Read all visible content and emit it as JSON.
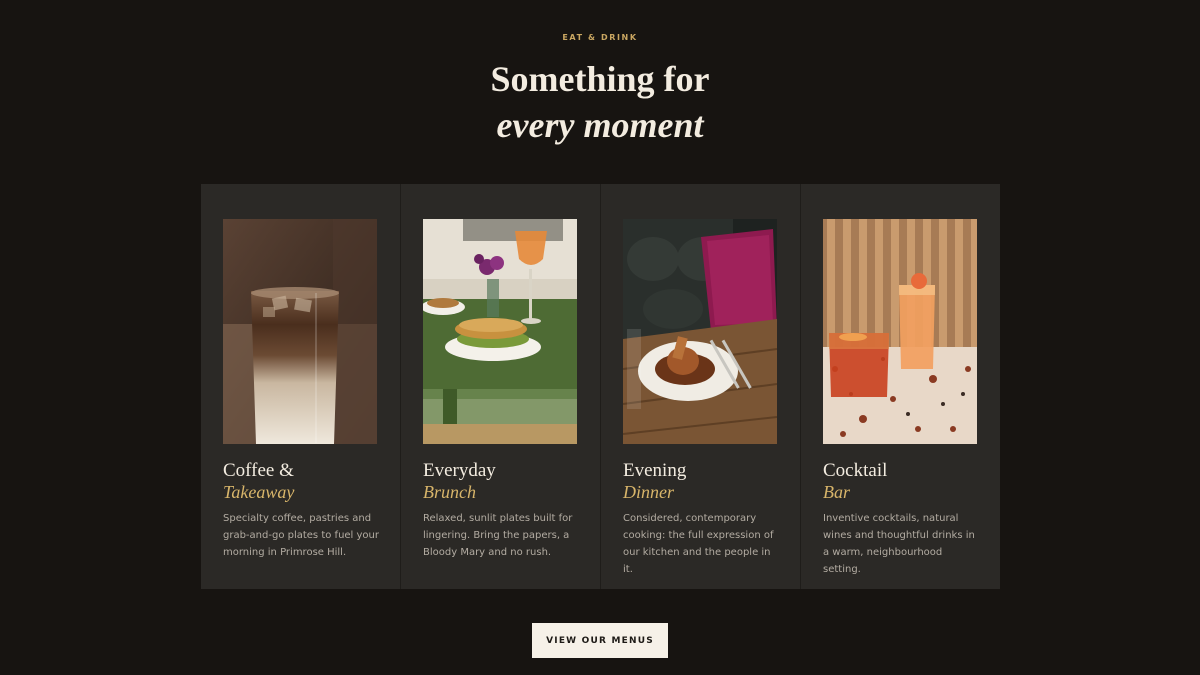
{
  "section": {
    "eyebrow": "EAT & DRINK",
    "heading_line1": "Something for",
    "heading_line2": "every moment"
  },
  "cards": [
    {
      "title": "Coffee &",
      "subtitle": "Takeaway",
      "description": "Specialty coffee, pastries and grab-and-go plates to fuel your morning in Primrose Hill.",
      "image": "iced-latte-photo"
    },
    {
      "title": "Everyday",
      "subtitle": "Brunch",
      "description": "Relaxed, sunlit plates built for lingering. Bring the papers, a Bloody Mary and no rush.",
      "image": "brunch-sandwich-photo"
    },
    {
      "title": "Evening",
      "subtitle": "Dinner",
      "description": "Considered, contemporary cooking: the full expression of our kitchen and the people in it.",
      "image": "dinner-plate-photo"
    },
    {
      "title": "Cocktail",
      "subtitle": "Bar",
      "description": "Inventive cocktails, natural wines and thoughtful drinks in a warm, neighbourhood setting.",
      "image": "cocktails-photo"
    }
  ],
  "cta": {
    "label": "VIEW OUR MENUS"
  },
  "colors": {
    "background": "#171411",
    "card": "#2b2926",
    "accent": "#d8b56a",
    "eyebrow": "#c9a661",
    "button_bg": "#f6f1e8"
  }
}
